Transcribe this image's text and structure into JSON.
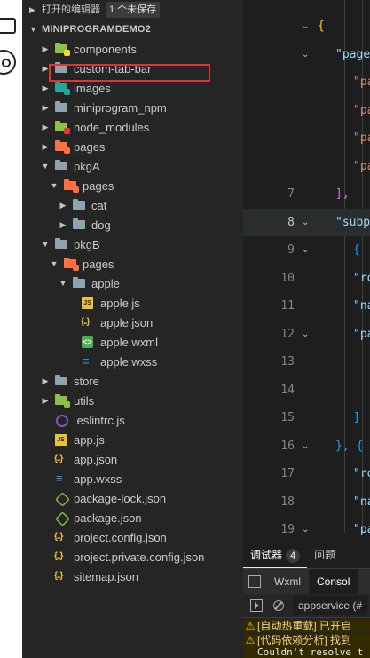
{
  "explorer": {
    "open_editors": "打开的编辑器",
    "unsaved_badge": "1 个未保存",
    "project_name": "MINIPROGRAMDEMO2",
    "tree": [
      {
        "label": "components",
        "type": "folder",
        "depth": 0,
        "expanded": false,
        "color": "#8bc34a",
        "badge_color": "#fdd835"
      },
      {
        "label": "custom-tab-bar",
        "type": "folder",
        "depth": 0,
        "expanded": false,
        "color": "#90a4ae",
        "highlighted": true
      },
      {
        "label": "images",
        "type": "folder",
        "depth": 0,
        "expanded": false,
        "color": "#26a69a",
        "badge_color": "#26a69a"
      },
      {
        "label": "miniprogram_npm",
        "type": "folder",
        "depth": 0,
        "expanded": false,
        "color": "#90a4ae"
      },
      {
        "label": "node_modules",
        "type": "folder",
        "depth": 0,
        "expanded": false,
        "color": "#8bc34a",
        "badge_color": "#e53935"
      },
      {
        "label": "pages",
        "type": "folder",
        "depth": 0,
        "expanded": false,
        "color": "#ff7043",
        "badge_color": "#ff7043"
      },
      {
        "label": "pkgA",
        "type": "folder",
        "depth": 0,
        "expanded": true,
        "color": "#90a4ae"
      },
      {
        "label": "pages",
        "type": "folder",
        "depth": 1,
        "expanded": true,
        "color": "#ff7043",
        "badge_color": "#ff7043"
      },
      {
        "label": "cat",
        "type": "folder",
        "depth": 2,
        "expanded": false,
        "color": "#90a4ae"
      },
      {
        "label": "dog",
        "type": "folder",
        "depth": 2,
        "expanded": false,
        "color": "#90a4ae"
      },
      {
        "label": "pkgB",
        "type": "folder",
        "depth": 0,
        "expanded": true,
        "color": "#90a4ae"
      },
      {
        "label": "pages",
        "type": "folder",
        "depth": 1,
        "expanded": true,
        "color": "#ff7043",
        "badge_color": "#ff7043"
      },
      {
        "label": "apple",
        "type": "folder",
        "depth": 2,
        "expanded": true,
        "color": "#90a4ae"
      },
      {
        "label": "apple.js",
        "type": "js",
        "depth": 3
      },
      {
        "label": "apple.json",
        "type": "json",
        "depth": 3
      },
      {
        "label": "apple.wxml",
        "type": "wxml",
        "depth": 3
      },
      {
        "label": "apple.wxss",
        "type": "wxss",
        "depth": 3
      },
      {
        "label": "store",
        "type": "folder",
        "depth": 0,
        "expanded": false,
        "color": "#90a4ae"
      },
      {
        "label": "utils",
        "type": "folder",
        "depth": 0,
        "expanded": false,
        "color": "#8bc34a",
        "badge_color": "#8bc34a"
      },
      {
        "label": ".eslintrc.js",
        "type": "eslint",
        "depth": 0
      },
      {
        "label": "app.js",
        "type": "js",
        "depth": 0
      },
      {
        "label": "app.json",
        "type": "json",
        "depth": 0
      },
      {
        "label": "app.wxss",
        "type": "wxss",
        "depth": 0
      },
      {
        "label": "package-lock.json",
        "type": "npm",
        "depth": 0
      },
      {
        "label": "package.json",
        "type": "npm",
        "depth": 0
      },
      {
        "label": "project.config.json",
        "type": "json",
        "depth": 0
      },
      {
        "label": "project.private.config.json",
        "type": "json",
        "depth": 0
      },
      {
        "label": "sitemap.json",
        "type": "json",
        "depth": 0
      }
    ]
  },
  "editor": {
    "lines": [
      {
        "num": "",
        "fold": true,
        "indent": 0,
        "parts": [
          {
            "t": "{",
            "c": "#ffd700"
          }
        ]
      },
      {
        "num": "",
        "fold": true,
        "indent": 1,
        "parts": [
          {
            "t": "\"page",
            "c": "#9cdcfe"
          }
        ]
      },
      {
        "num": "",
        "fold": false,
        "indent": 2,
        "parts": [
          {
            "t": "\"pa",
            "c": "#ce9178"
          }
        ]
      },
      {
        "num": "",
        "fold": false,
        "indent": 2,
        "parts": [
          {
            "t": "\"pa",
            "c": "#ce9178"
          }
        ]
      },
      {
        "num": "",
        "fold": false,
        "indent": 2,
        "parts": [
          {
            "t": "\"pa",
            "c": "#ce9178"
          }
        ]
      },
      {
        "num": "",
        "fold": false,
        "indent": 2,
        "parts": [
          {
            "t": "\"pa",
            "c": "#ce9178"
          }
        ]
      },
      {
        "num": "7",
        "fold": false,
        "indent": 1,
        "parts": [
          {
            "t": "],",
            "c": "#da70d6"
          }
        ]
      },
      {
        "num": "8",
        "fold": true,
        "indent": 1,
        "current": true,
        "parts": [
          {
            "t": "\"subp",
            "c": "#9cdcfe"
          }
        ]
      },
      {
        "num": "9",
        "fold": true,
        "indent": 2,
        "parts": [
          {
            "t": "{",
            "c": "#179fff"
          }
        ]
      },
      {
        "num": "10",
        "fold": false,
        "indent": 2,
        "parts": [
          {
            "t": "\"ro",
            "c": "#9cdcfe"
          }
        ]
      },
      {
        "num": "11",
        "fold": false,
        "indent": 2,
        "parts": [
          {
            "t": "\"na",
            "c": "#9cdcfe"
          }
        ]
      },
      {
        "num": "12",
        "fold": true,
        "indent": 2,
        "parts": [
          {
            "t": "\"pa",
            "c": "#9cdcfe"
          }
        ]
      },
      {
        "num": "13",
        "fold": false,
        "indent": 3,
        "parts": [
          {
            "t": "\"",
            "c": "#ce9178"
          }
        ]
      },
      {
        "num": "14",
        "fold": false,
        "indent": 3,
        "parts": [
          {
            "t": "\"",
            "c": "#ce9178"
          }
        ]
      },
      {
        "num": "15",
        "fold": false,
        "indent": 2,
        "parts": [
          {
            "t": "]",
            "c": "#179fff"
          }
        ]
      },
      {
        "num": "16",
        "fold": true,
        "indent": 1,
        "parts": [
          {
            "t": "}, {",
            "c": "#179fff"
          }
        ]
      },
      {
        "num": "17",
        "fold": false,
        "indent": 2,
        "parts": [
          {
            "t": "\"ro",
            "c": "#9cdcfe"
          }
        ]
      },
      {
        "num": "18",
        "fold": false,
        "indent": 2,
        "parts": [
          {
            "t": "\"na",
            "c": "#9cdcfe"
          }
        ]
      },
      {
        "num": "19",
        "fold": true,
        "indent": 2,
        "parts": [
          {
            "t": "\"pa",
            "c": "#9cdcfe"
          }
        ]
      }
    ]
  },
  "panel": {
    "tabs": [
      {
        "label": "调试器",
        "count": "4",
        "active": true
      },
      {
        "label": "问题",
        "active": false
      }
    ],
    "devtools_tabs": [
      {
        "label": "Wxml",
        "active": false
      },
      {
        "label": "Consol",
        "active": true
      }
    ],
    "context": "appservice (#",
    "messages": [
      {
        "line1": "[自动热重载] 已开启",
        "line2": ""
      },
      {
        "line1": "[代码依赖分析] 找到",
        "line2": "Couldn't resolve t"
      }
    ]
  }
}
